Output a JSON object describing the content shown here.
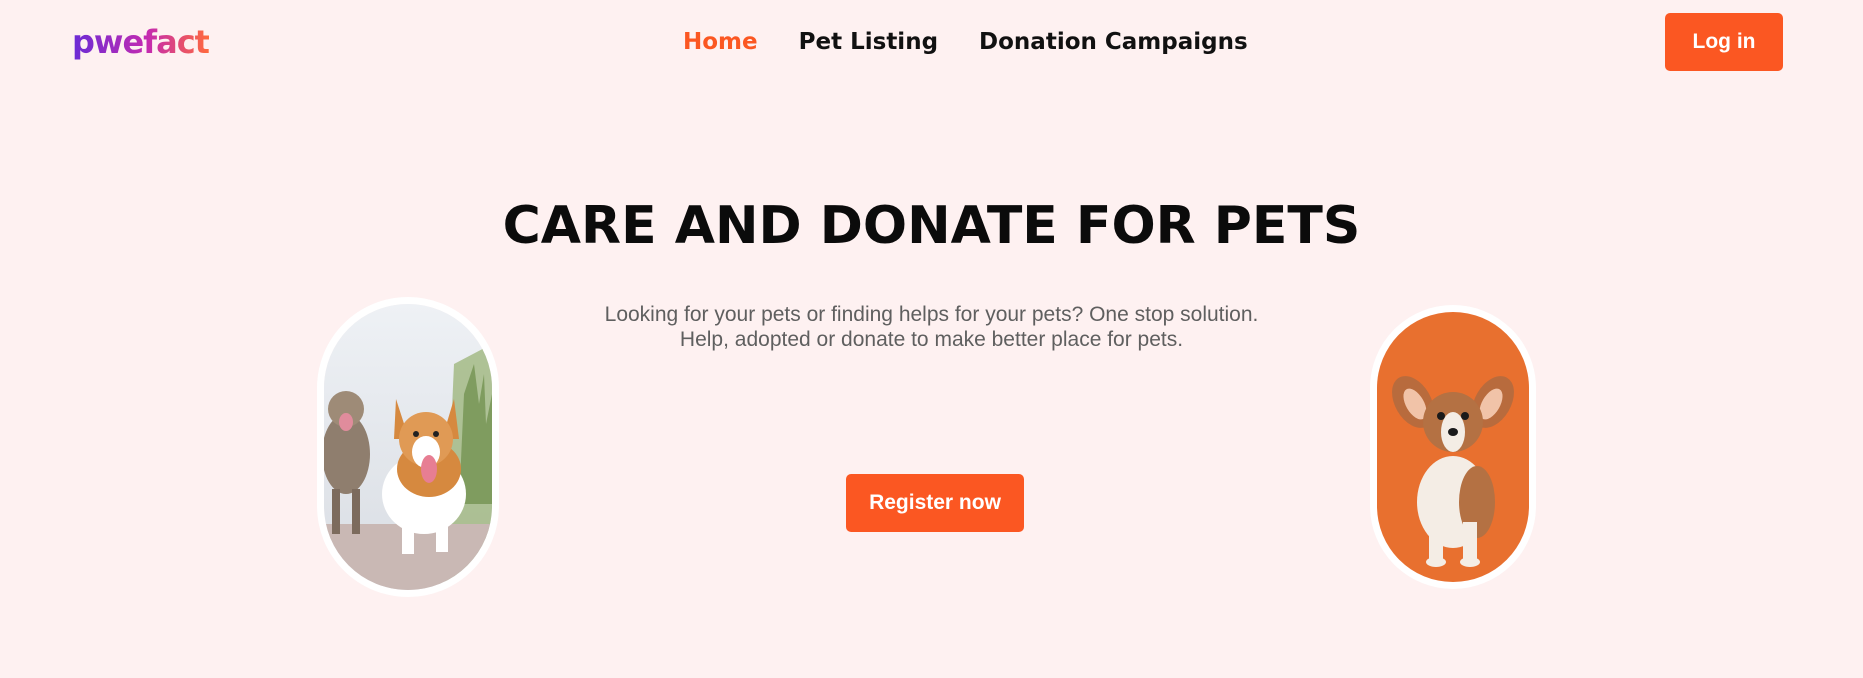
{
  "header": {
    "logo_text": "pwefact",
    "nav": [
      {
        "label": "Home",
        "active": true
      },
      {
        "label": "Pet Listing",
        "active": false
      },
      {
        "label": "Donation Campaigns",
        "active": false
      }
    ],
    "login_label": "Log in"
  },
  "hero": {
    "title": "CARE AND DONATE FOR PETS",
    "subtitle_line1": "Looking for your pets or finding helps for your pets? One stop solution.",
    "subtitle_line2": "Help, adopted or donate to make better place for pets.",
    "register_label": "Register now"
  },
  "images": {
    "left": "dogs-walking-photo",
    "right": "corgi-puppy-photo"
  },
  "colors": {
    "accent": "#fb5722",
    "background": "#fef1f1"
  }
}
